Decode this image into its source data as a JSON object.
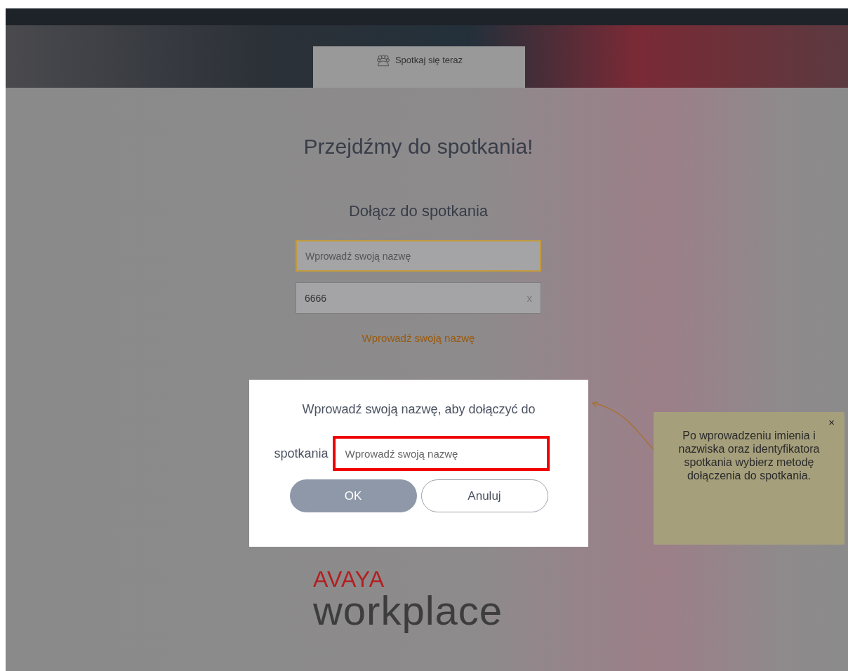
{
  "tab": {
    "label": "Spotkaj się teraz",
    "selected": true
  },
  "heading": "Przejdźmy do spotkania!",
  "subheading": "Dołącz do spotkania",
  "name_field": {
    "placeholder": "Wprowadź swoją nazwę"
  },
  "meeting_id_field": {
    "value": "6666",
    "clear": "x"
  },
  "error": "Wprowadź swoją nazwę",
  "dialog": {
    "message_lines": [
      "Wprowadź swoją nazwę, aby dołączyć do",
      "spotkania"
    ],
    "field": {
      "placeholder": "Wprowadź swoją nazwę"
    },
    "buttons": [
      {
        "label": "OK",
        "kind": "primary"
      },
      {
        "label": "Anuluj",
        "kind": "secondary"
      }
    ]
  },
  "tooltip": {
    "text": "Po wprowadzeniu imienia i nazwiska oraz identyfikatora spotkania wybierz metodę dołączenia do spotkania.",
    "close": "×"
  },
  "logo": {
    "brand": "AVAYA",
    "product": "workplace"
  }
}
